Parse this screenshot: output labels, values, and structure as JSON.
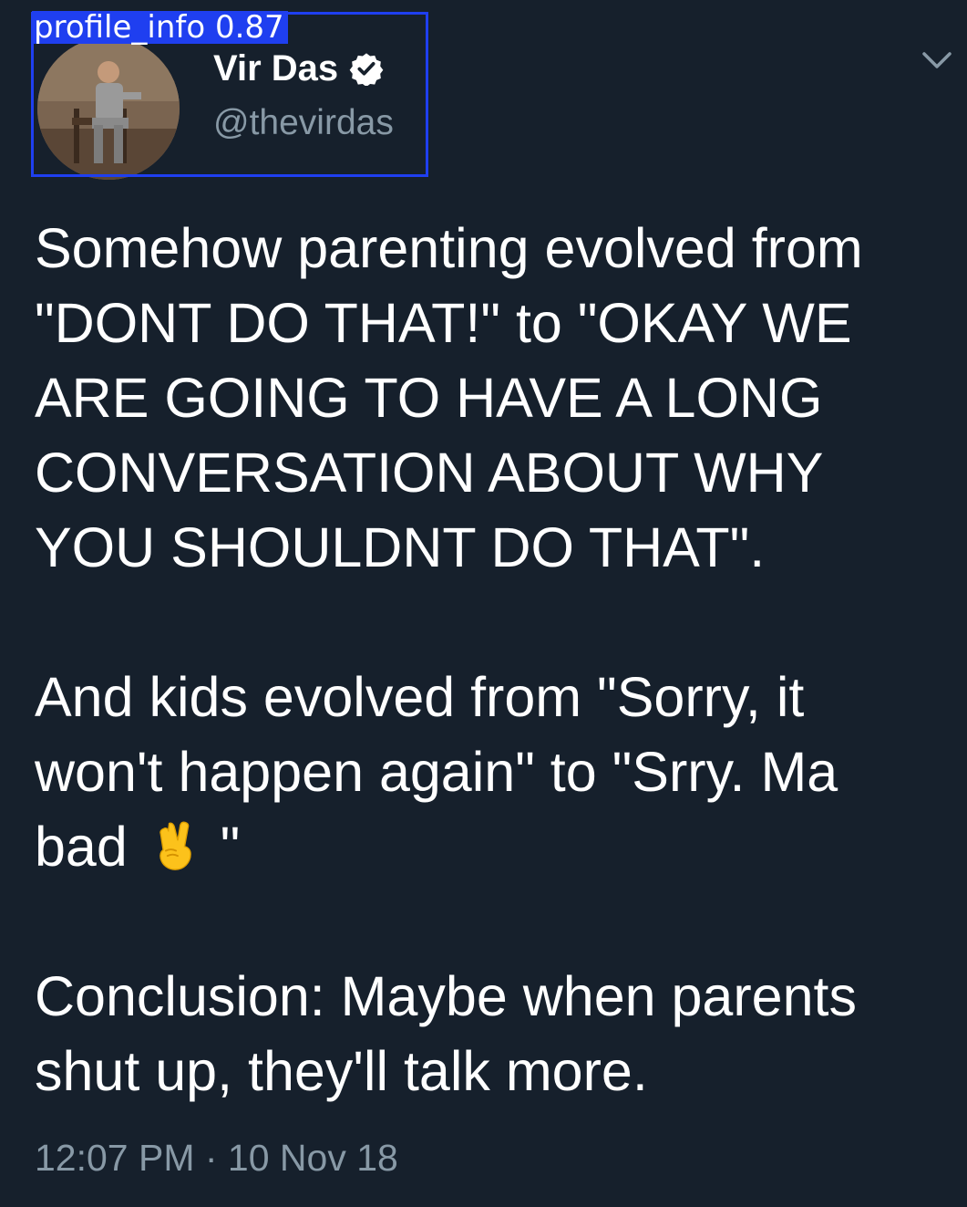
{
  "detection": {
    "label": "profile_info",
    "score": "0.87",
    "color": "#1f3ff0"
  },
  "user": {
    "display_name": "Vir Das",
    "handle": "@thevirdas",
    "verified": true,
    "verified_icon": "verified-badge-icon"
  },
  "menu": {
    "icon": "chevron-down-icon"
  },
  "tweet": {
    "lines": [
      "Somehow parenting evolved from",
      "\"DONT DO THAT!\" to \"OKAY WE",
      "ARE GOING TO HAVE A LONG",
      "CONVERSATION ABOUT WHY",
      "YOU SHOULDNT DO THAT\".",
      "",
      "And kids evolved from \"Sorry, it",
      "won't happen again\" to \"Srry. Ma",
      "bad ",
      "",
      "Conclusion: Maybe when parents",
      "shut up, they'll talk more."
    ],
    "emoji": "victory-hand-icon",
    "after_emoji": " \""
  },
  "meta": {
    "timestamp": "12:07 PM · 10 Nov 18"
  },
  "colors": {
    "background": "#16202c",
    "text": "#ffffff",
    "secondary": "#8899a6"
  }
}
